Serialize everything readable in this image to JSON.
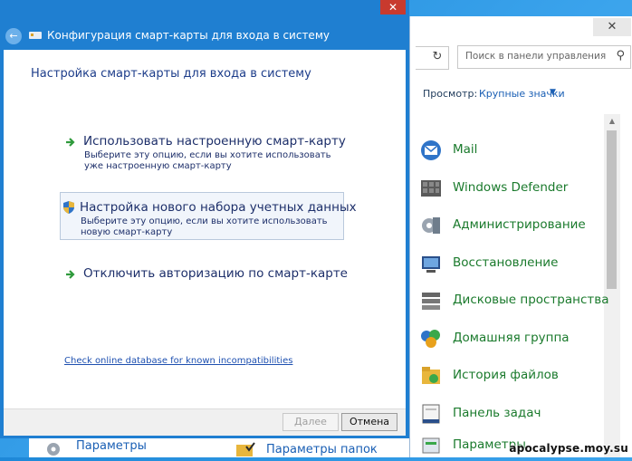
{
  "dialog": {
    "title": "Конфигурация смарт-карты для входа в систему",
    "heading": "Настройка смарт-карты для входа в систему",
    "options": [
      {
        "title": "Использовать настроенную смарт-карту",
        "description": "Выберите эту опцию, если вы хотите использовать уже настроенную смарт-карту"
      },
      {
        "title": "Настройка нового набора учетных данных",
        "description": "Выберите эту опцию, если вы хотите использовать новую смарт-карту"
      },
      {
        "title": "Отключить авторизацию по смарт-карте",
        "description": ""
      }
    ],
    "compat_link": "Check online database for known incompatibilities",
    "buttons": {
      "next": "Далее",
      "cancel": "Отмена"
    }
  },
  "control_panel": {
    "search_placeholder": "Поиск в панели управления",
    "view_label": "Просмотр:",
    "view_value": "Крупные значки",
    "items": [
      {
        "label": "Mail",
        "icon": "mail-icon"
      },
      {
        "label": "Windows Defender",
        "icon": "defender-icon"
      },
      {
        "label": "Администрирование",
        "icon": "admin-tools-icon"
      },
      {
        "label": "Восстановление",
        "icon": "recovery-icon"
      },
      {
        "label": "Дисковые пространства",
        "icon": "storage-spaces-icon"
      },
      {
        "label": "Домашняя группа",
        "icon": "homegroup-icon"
      },
      {
        "label": "История файлов",
        "icon": "file-history-icon"
      },
      {
        "label": "Панель задач",
        "icon": "taskbar-icon"
      },
      {
        "label": "Параметры",
        "icon": "settings-icon"
      }
    ]
  },
  "background_window": {
    "items": [
      {
        "label": "Параметры"
      },
      {
        "label": "Параметры папок"
      }
    ]
  },
  "watermark": "apocalypse.moy.su",
  "colors": {
    "desktop": "#3aa3ec",
    "dialog_title_bar": "#1f7fd1",
    "cp_item_text": "#1a7a2c",
    "close_button": "#c83a2e"
  }
}
